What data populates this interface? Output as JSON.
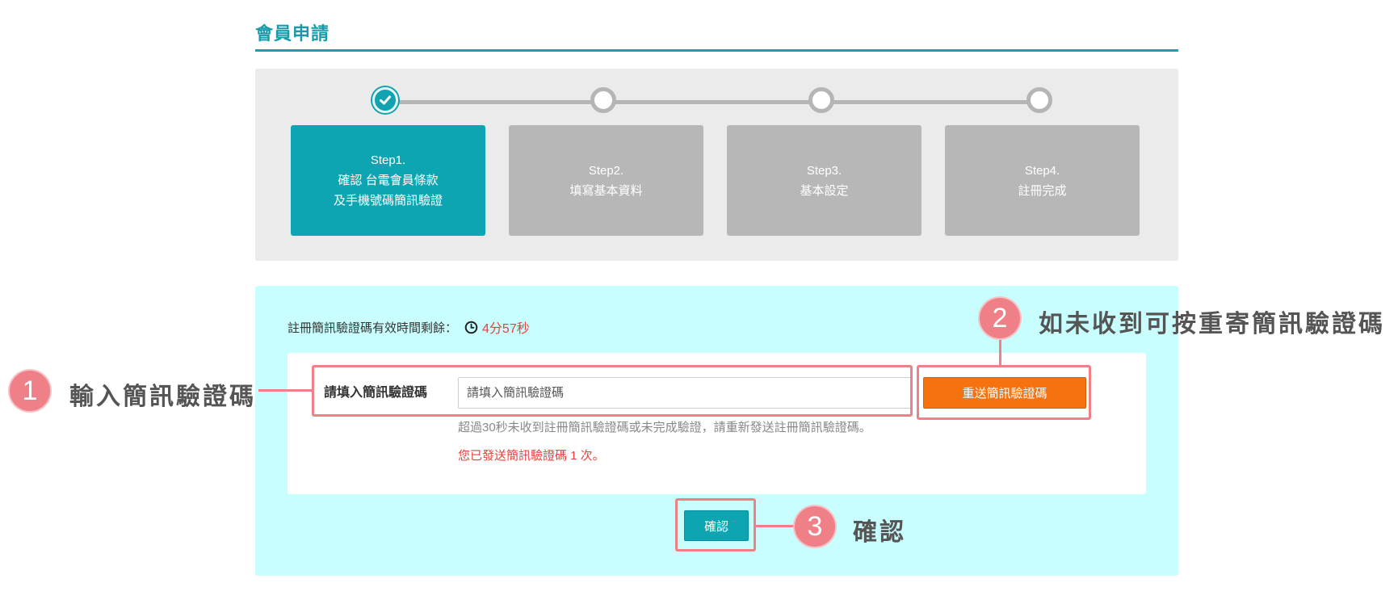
{
  "page_title": "會員申請",
  "steps": [
    {
      "num": "Step1.",
      "lines": [
        "確認 台電會員條款",
        "及手機號碼簡訊驗證"
      ],
      "state": "done"
    },
    {
      "num": "Step2.",
      "lines": [
        "填寫基本資料"
      ],
      "state": "pending"
    },
    {
      "num": "Step3.",
      "lines": [
        "基本設定"
      ],
      "state": "pending"
    },
    {
      "num": "Step4.",
      "lines": [
        "註冊完成"
      ],
      "state": "pending"
    }
  ],
  "timer": {
    "label": "註冊簡訊驗證碼有效時間剩餘：",
    "value": "4分57秒",
    "icon": "clock-icon"
  },
  "form": {
    "label": "請填入簡訊驗證碼",
    "input_placeholder": "請填入簡訊驗證碼",
    "input_value": "",
    "resend_label": "重送簡訊驗證碼",
    "hint": "超過30秒未收到註冊簡訊驗證碼或未完成驗證，請重新發送註冊簡訊驗證碼。",
    "sent_note": "您已發送簡訊驗證碼 1 次。"
  },
  "confirm_label": "確認",
  "annotations": [
    {
      "num": "1",
      "text": "輸入簡訊驗證碼"
    },
    {
      "num": "2",
      "text": "如未收到可按重寄簡訊驗證碼"
    },
    {
      "num": "3",
      "text": "確認"
    }
  ],
  "colors": {
    "accent": "#12a3b1",
    "resend": "#f5720f",
    "alert": "#e8413c",
    "annotation": "#ef8088",
    "verify_bg": "#c8fefe"
  }
}
